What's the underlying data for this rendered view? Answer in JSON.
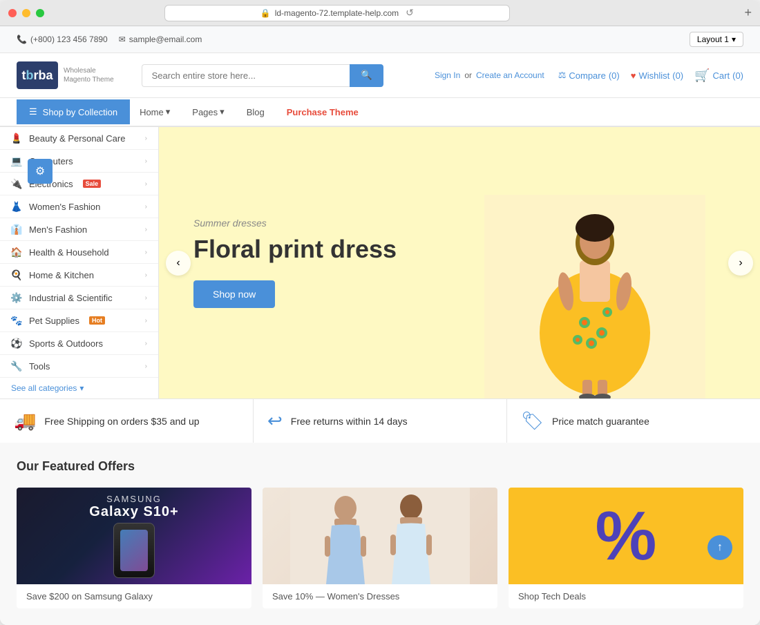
{
  "window": {
    "title": "ld-magento-72.template-help.com"
  },
  "topbar": {
    "phone": "(+800) 123 456 7890",
    "email": "sample@email.com",
    "layout_label": "Layout 1"
  },
  "header": {
    "logo_text": "tbrba",
    "logo_wholesale": "Wholesale",
    "logo_magento": "Magento Theme",
    "search_placeholder": "Search entire store here...",
    "sign_in": "Sign In",
    "or_text": "or",
    "create_account": "Create an Account",
    "compare_label": "Compare",
    "compare_count": "(0)",
    "wishlist_label": "Wishlist",
    "wishlist_count": "(0)",
    "cart_label": "Cart",
    "cart_count": "(0)"
  },
  "nav": {
    "shop_label": "Shop by Collection",
    "links": [
      {
        "label": "Home",
        "has_arrow": true
      },
      {
        "label": "Pages",
        "has_arrow": true
      },
      {
        "label": "Blog",
        "has_arrow": false
      },
      {
        "label": "Purchase Theme",
        "is_accent": true
      }
    ]
  },
  "sidebar": {
    "items": [
      {
        "label": "Beauty & Personal Care",
        "icon": "💄",
        "badge": null
      },
      {
        "label": "Computers",
        "icon": "💻",
        "badge": null
      },
      {
        "label": "Electronics",
        "icon": "🔌",
        "badge": "Sale"
      },
      {
        "label": "Women's Fashion",
        "icon": "👗",
        "badge": null
      },
      {
        "label": "Men's Fashion",
        "icon": "👔",
        "badge": null
      },
      {
        "label": "Health & Household",
        "icon": "🏠",
        "badge": null
      },
      {
        "label": "Home & Kitchen",
        "icon": "🍳",
        "badge": null
      },
      {
        "label": "Industrial & Scientific",
        "icon": "⚙️",
        "badge": null
      },
      {
        "label": "Pet Supplies",
        "icon": "🐾",
        "badge": "Hot"
      },
      {
        "label": "Sports & Outdoors",
        "icon": "⚽",
        "badge": null
      },
      {
        "label": "Tools",
        "icon": "🔧",
        "badge": null
      }
    ],
    "see_all": "See all categories"
  },
  "hero": {
    "subtitle": "Summer dresses",
    "title": "Floral print dress",
    "btn_label": "Shop now",
    "prev_icon": "‹",
    "next_icon": "›"
  },
  "benefits": [
    {
      "icon": "🚚",
      "text": "Free Shipping on orders $35 and up"
    },
    {
      "icon": "↩",
      "text": "Free returns within 14 days"
    },
    {
      "icon": "🏷",
      "text": "Price match guarantee"
    }
  ],
  "featured": {
    "title": "Our Featured Offers",
    "cards": [
      {
        "label": "Save $200 on Samsung Galaxy",
        "img_type": "galaxy",
        "img_text": "Galaxy S10+"
      },
      {
        "label": "Save 10% — Women's Dresses",
        "img_type": "women",
        "img_text": ""
      },
      {
        "label": "Shop Tech Deals",
        "img_type": "promo",
        "img_text": "%"
      }
    ]
  }
}
